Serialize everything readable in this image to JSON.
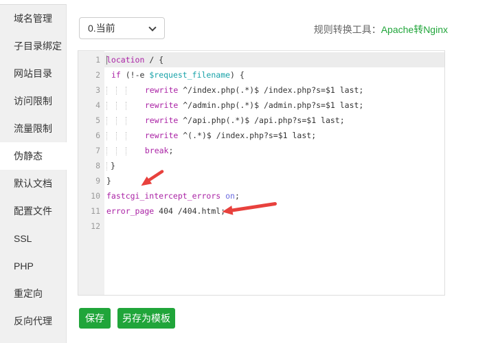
{
  "sidebar": {
    "items": [
      {
        "label": "域名管理",
        "active": false
      },
      {
        "label": "子目录绑定",
        "active": false
      },
      {
        "label": "网站目录",
        "active": false
      },
      {
        "label": "访问限制",
        "active": false
      },
      {
        "label": "流量限制",
        "active": false
      },
      {
        "label": "伪静态",
        "active": true
      },
      {
        "label": "默认文档",
        "active": false
      },
      {
        "label": "配置文件",
        "active": false
      },
      {
        "label": "SSL",
        "active": false
      },
      {
        "label": "PHP",
        "active": false
      },
      {
        "label": "重定向",
        "active": false
      },
      {
        "label": "反向代理",
        "active": false
      }
    ]
  },
  "toolbar": {
    "profile_value": "0.当前",
    "converter_label": "规则转换工具：",
    "converter_link": "Apache转Nginx"
  },
  "editor": {
    "cursor_line": 1,
    "lines": [
      {
        "n": 1,
        "active": true,
        "seg": [
          [
            "kw",
            "location"
          ],
          [
            "d",
            " / {"
          ]
        ]
      },
      {
        "n": 2,
        "seg": [
          [
            "d",
            " "
          ],
          [
            "kw",
            "if"
          ],
          [
            "d",
            " (!-e "
          ],
          [
            "var",
            "$request_filename"
          ],
          [
            "d",
            ") {"
          ]
        ]
      },
      {
        "n": 3,
        "seg": [
          [
            "tab",
            ""
          ],
          [
            "tab",
            ""
          ],
          [
            "tab",
            ""
          ],
          [
            "d",
            "  "
          ],
          [
            "kw",
            "rewrite"
          ],
          [
            "d",
            " ^/index.php(.*)$ /index.php?s=$1 last;"
          ]
        ]
      },
      {
        "n": 4,
        "seg": [
          [
            "tab",
            ""
          ],
          [
            "tab",
            ""
          ],
          [
            "tab",
            ""
          ],
          [
            "d",
            "  "
          ],
          [
            "kw",
            "rewrite"
          ],
          [
            "d",
            " ^/admin.php(.*)$ /admin.php?s=$1 last;"
          ]
        ]
      },
      {
        "n": 5,
        "seg": [
          [
            "tab",
            ""
          ],
          [
            "tab",
            ""
          ],
          [
            "tab",
            ""
          ],
          [
            "d",
            "  "
          ],
          [
            "kw",
            "rewrite"
          ],
          [
            "d",
            " ^/api.php(.*)$ /api.php?s=$1 last;"
          ]
        ]
      },
      {
        "n": 6,
        "seg": [
          [
            "tab",
            ""
          ],
          [
            "tab",
            ""
          ],
          [
            "tab",
            ""
          ],
          [
            "d",
            "  "
          ],
          [
            "kw",
            "rewrite"
          ],
          [
            "d",
            " ^(.*)$ /index.php?s=$1 last;"
          ]
        ]
      },
      {
        "n": 7,
        "seg": [
          [
            "tab",
            ""
          ],
          [
            "tab",
            ""
          ],
          [
            "tab",
            ""
          ],
          [
            "d",
            "  "
          ],
          [
            "kw",
            "break"
          ],
          [
            "d",
            ";"
          ]
        ]
      },
      {
        "n": 8,
        "seg": [
          [
            "tabn",
            ""
          ],
          [
            "d",
            "}"
          ]
        ]
      },
      {
        "n": 9,
        "seg": [
          [
            "d",
            "}"
          ]
        ]
      },
      {
        "n": 10,
        "seg": [
          [
            "kw",
            "fastcgi_intercept_errors"
          ],
          [
            "d",
            " "
          ],
          [
            "atom",
            "on"
          ],
          [
            "d",
            ";"
          ]
        ]
      },
      {
        "n": 11,
        "seg": [
          [
            "kw",
            "error_page"
          ],
          [
            "d",
            " 404 /404.html;"
          ]
        ]
      },
      {
        "n": 12,
        "seg": []
      }
    ]
  },
  "buttons": {
    "save": "保存",
    "save_as_template": "另存为模板"
  },
  "colors": {
    "accent": "#20a53a",
    "keyword": "#aa22a5",
    "variable": "#17a2a8",
    "atom": "#6b6be0",
    "arrow": "#e8413d",
    "sidebar_bg": "#f0f0f0",
    "active_line_bg": "#ececec"
  }
}
